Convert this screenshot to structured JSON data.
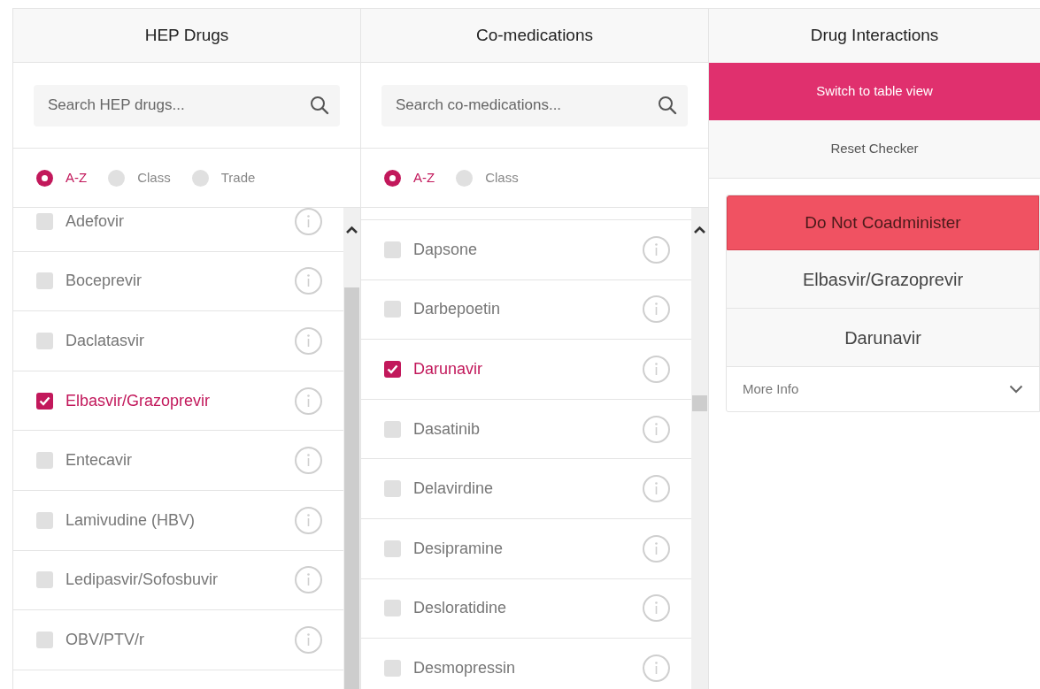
{
  "columns": [
    {
      "title": "HEP Drugs",
      "search": {
        "placeholder": "Search HEP drugs..."
      },
      "sort_options": [
        {
          "label": "A-Z",
          "selected": true
        },
        {
          "label": "Class",
          "selected": false
        },
        {
          "label": "Trade",
          "selected": false
        }
      ],
      "items": [
        {
          "name": "Adefovir",
          "checked": false
        },
        {
          "name": "Boceprevir",
          "checked": false
        },
        {
          "name": "Daclatasvir",
          "checked": false
        },
        {
          "name": "Elbasvir/Grazoprevir",
          "checked": true
        },
        {
          "name": "Entecavir",
          "checked": false
        },
        {
          "name": "Lamivudine (HBV)",
          "checked": false
        },
        {
          "name": "Ledipasvir/Sofosbuvir",
          "checked": false
        },
        {
          "name": "OBV/PTV/r",
          "checked": false
        }
      ]
    },
    {
      "title": "Co-medications",
      "search": {
        "placeholder": "Search co-medications..."
      },
      "sort_options": [
        {
          "label": "A-Z",
          "selected": true
        },
        {
          "label": "Class",
          "selected": false
        }
      ],
      "items": [
        {
          "name": "Dapsone",
          "checked": false
        },
        {
          "name": "Darbepoetin",
          "checked": false
        },
        {
          "name": "Darunavir",
          "checked": true
        },
        {
          "name": "Dasatinib",
          "checked": false
        },
        {
          "name": "Delavirdine",
          "checked": false
        },
        {
          "name": "Desipramine",
          "checked": false
        },
        {
          "name": "Desloratidine",
          "checked": false
        },
        {
          "name": "Desmopressin",
          "checked": false
        }
      ]
    }
  ],
  "interactions": {
    "title": "Drug Interactions",
    "buttons": [
      {
        "label": "Switch to table view",
        "kind": "primary"
      },
      {
        "label": "Reset Checker",
        "kind": "secondary"
      }
    ],
    "result": {
      "severity": "Do Not Coadminister",
      "drugs": [
        "Elbasvir/Grazoprevir",
        "Darunavir"
      ],
      "more_info": "More Info",
      "expanded": false
    }
  }
}
